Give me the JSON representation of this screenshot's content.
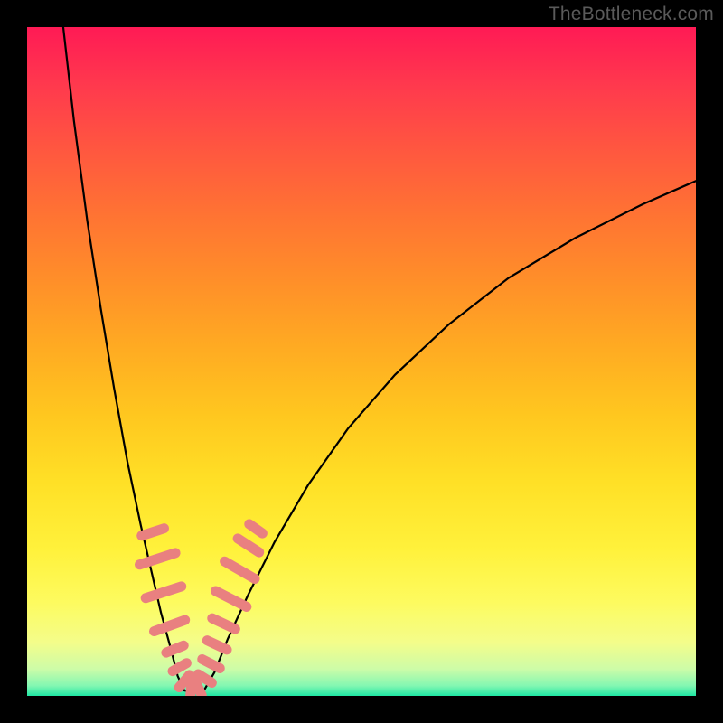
{
  "watermark": "TheBottleneck.com",
  "colors": {
    "background_frame": "#000000",
    "gradient_top": "#ff1a55",
    "gradient_bottom": "#1fe7a4",
    "curve_stroke": "#000000",
    "marker_fill": "#e98080"
  },
  "chart_data": {
    "type": "line",
    "title": "",
    "xlabel": "",
    "ylabel": "",
    "xlim": [
      0,
      100
    ],
    "ylim": [
      0,
      100
    ],
    "description": "Bottleneck-style chart: two black curves descending into a V-shaped minimum near x≈23 against a vertical red→yellow→green gradient. Pink capsule-shaped markers cluster along both curves near the minimum.",
    "series": [
      {
        "name": "left-curve",
        "x": [
          5.4,
          7.0,
          9.0,
          11.0,
          13.0,
          15.0,
          17.0,
          18.5,
          20.0,
          21.5,
          22.5,
          23.5
        ],
        "y": [
          100.0,
          86.0,
          71.0,
          58.0,
          46.0,
          35.0,
          25.5,
          19.0,
          12.5,
          7.0,
          3.0,
          0.8
        ]
      },
      {
        "name": "valley-floor",
        "x": [
          23.5,
          25.0,
          26.5
        ],
        "y": [
          0.8,
          0.5,
          0.9
        ]
      },
      {
        "name": "right-curve",
        "x": [
          26.5,
          28.0,
          30.0,
          33.0,
          37.0,
          42.0,
          48.0,
          55.0,
          63.0,
          72.0,
          82.0,
          92.0,
          100.0
        ],
        "y": [
          0.9,
          3.5,
          8.5,
          15.0,
          23.0,
          31.5,
          40.0,
          48.0,
          55.5,
          62.5,
          68.5,
          73.5,
          77.0
        ]
      }
    ],
    "markers": [
      {
        "x": 18.8,
        "y": 24.5,
        "angle_deg": -72,
        "len": 3.0
      },
      {
        "x": 19.5,
        "y": 20.5,
        "angle_deg": -72,
        "len": 4.5
      },
      {
        "x": 20.4,
        "y": 15.5,
        "angle_deg": -72,
        "len": 4.5
      },
      {
        "x": 21.3,
        "y": 10.5,
        "angle_deg": -70,
        "len": 4.0
      },
      {
        "x": 22.1,
        "y": 7.0,
        "angle_deg": -68,
        "len": 2.5
      },
      {
        "x": 22.8,
        "y": 4.3,
        "angle_deg": -60,
        "len": 2.2
      },
      {
        "x": 23.5,
        "y": 2.2,
        "angle_deg": -40,
        "len": 2.2
      },
      {
        "x": 24.5,
        "y": 1.0,
        "angle_deg": -5,
        "len": 2.2
      },
      {
        "x": 25.6,
        "y": 1.2,
        "angle_deg": 25,
        "len": 2.2
      },
      {
        "x": 26.6,
        "y": 2.6,
        "angle_deg": 58,
        "len": 2.2
      },
      {
        "x": 27.5,
        "y": 4.8,
        "angle_deg": 63,
        "len": 2.6
      },
      {
        "x": 28.4,
        "y": 7.6,
        "angle_deg": 65,
        "len": 2.8
      },
      {
        "x": 29.4,
        "y": 10.8,
        "angle_deg": 65,
        "len": 3.2
      },
      {
        "x": 30.5,
        "y": 14.5,
        "angle_deg": 63,
        "len": 4.2
      },
      {
        "x": 31.8,
        "y": 18.8,
        "angle_deg": 60,
        "len": 4.2
      },
      {
        "x": 33.1,
        "y": 22.5,
        "angle_deg": 57,
        "len": 3.2
      },
      {
        "x": 34.2,
        "y": 25.0,
        "angle_deg": 55,
        "len": 2.2
      }
    ]
  }
}
